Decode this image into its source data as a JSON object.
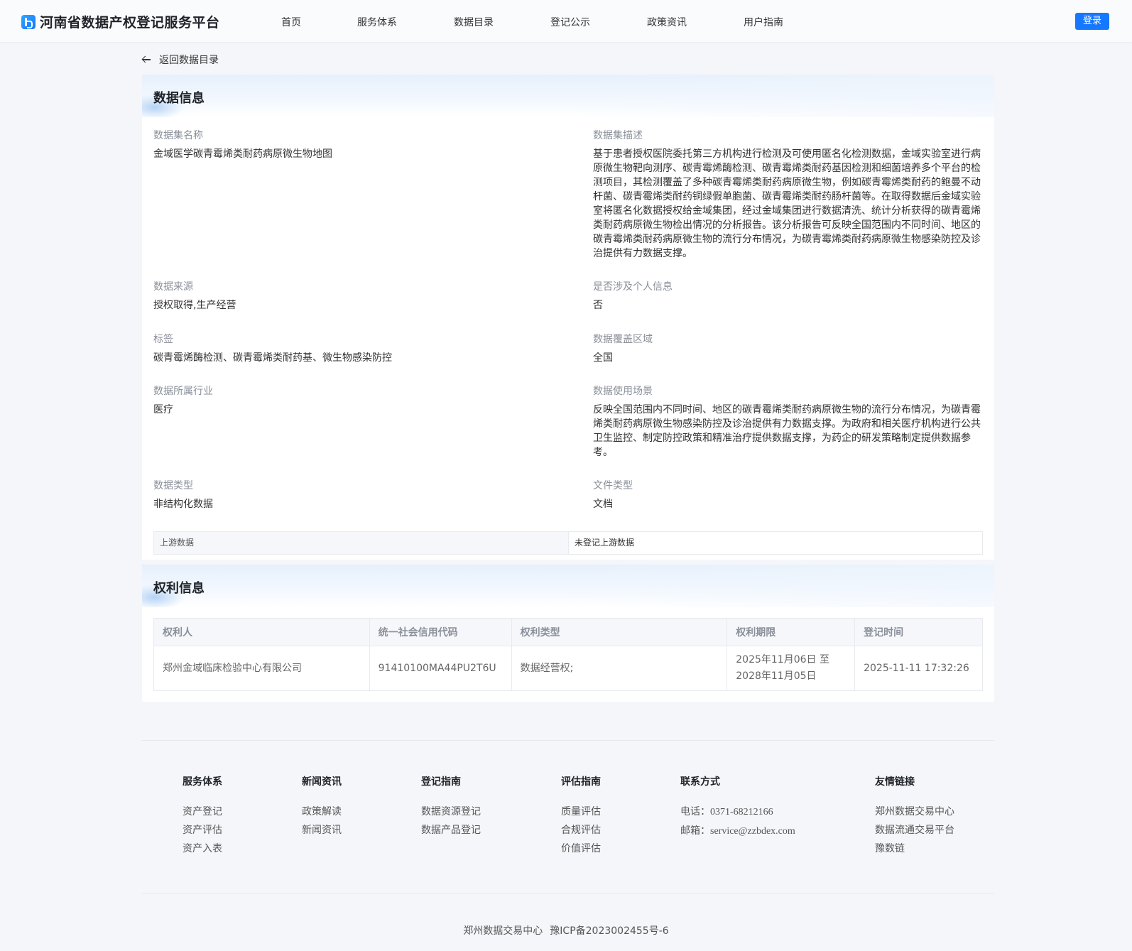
{
  "header": {
    "site_title": "河南省数据产权登记服务平台",
    "nav": [
      "首页",
      "服务体系",
      "数据目录",
      "登记公示",
      "政策资讯",
      "用户指南"
    ],
    "login_label": "登录",
    "brand_color": "#1677ff"
  },
  "back_link": "返回数据目录",
  "data_info": {
    "title": "数据信息",
    "fields": {
      "dataset_name": {
        "label": "数据集名称",
        "value": "金域医学碳青霉烯类耐药病原微生物地图"
      },
      "dataset_desc": {
        "label": "数据集描述",
        "value": "基于患者授权医院委托第三方机构进行检测及可使用匿名化检测数据，金域实验室进行病原微生物靶向测序、碳青霉烯酶检测、碳青霉烯类耐药基因检测和细菌培养多个平台的检测项目，其检测覆盖了多种碳青霉烯类耐药病原微生物，例如碳青霉烯类耐药的鲍曼不动杆菌、碳青霉烯类耐药铜绿假单胞菌、碳青霉烯类耐药肠杆菌等。在取得数据后金域实验室将匿名化数据授权给金域集团，经过金域集团进行数据清洗、统计分析获得的碳青霉烯类耐药病原微生物检出情况的分析报告。该分析报告可反映全国范围内不同时间、地区的碳青霉烯类耐药病原微生物的流行分布情况，为碳青霉烯类耐药病原微生物感染防控及诊治提供有力数据支撑。"
      },
      "data_source": {
        "label": "数据来源",
        "value": "授权取得,生产经营"
      },
      "personal_info": {
        "label": "是否涉及个人信息",
        "value": "否"
      },
      "tags": {
        "label": "标签",
        "value": "碳青霉烯酶检测、碳青霉烯类耐药基、微生物感染防控"
      },
      "coverage": {
        "label": "数据覆盖区域",
        "value": "全国"
      },
      "industry": {
        "label": "数据所属行业",
        "value": "医疗"
      },
      "scenario": {
        "label": "数据使用场景",
        "value": "反映全国范围内不同时间、地区的碳青霉烯类耐药病原微生物的流行分布情况，为碳青霉烯类耐药病原微生物感染防控及诊治提供有力数据支撑。为政府和相关医疗机构进行公共卫生监控、制定防控政策和精准治疗提供数据支撑，为药企的研发策略制定提供数据参考。"
      },
      "data_type": {
        "label": "数据类型",
        "value": "非结构化数据"
      },
      "file_type": {
        "label": "文件类型",
        "value": "文档"
      }
    },
    "upstream": {
      "label": "上游数据",
      "value": "未登记上游数据"
    }
  },
  "rights_info": {
    "title": "权利信息",
    "columns": [
      "权利人",
      "统一社会信用代码",
      "权利类型",
      "权利期限",
      "登记时间"
    ],
    "rows": [
      {
        "holder": "郑州金域临床检验中心有限公司",
        "credit_code": "91410100MA44PU2T6U",
        "right_type": "数据经营权;",
        "term_line1": "2025年11月06日 至",
        "term_line2": "2028年11月05日",
        "registered_at": "2025-11-11 17:32:26"
      }
    ]
  },
  "footer": {
    "columns": [
      {
        "title": "服务体系",
        "links": [
          "资产登记",
          "资产评估",
          "资产入表"
        ]
      },
      {
        "title": "新闻资讯",
        "links": [
          "政策解读",
          "新闻资讯"
        ]
      },
      {
        "title": "登记指南",
        "links": [
          "数据资源登记",
          "数据产品登记"
        ]
      },
      {
        "title": "评估指南",
        "links": [
          "质量评估",
          "合规评估",
          "价值评估"
        ]
      },
      {
        "title": "联系方式",
        "phone_label": "电话：",
        "phone": "0371-68212166",
        "email_label": "邮箱：",
        "email": "service@zzbdex.com"
      },
      {
        "title": "友情链接",
        "links": [
          "郑州数据交易中心",
          "数据流通交易平台",
          "豫数链"
        ]
      }
    ],
    "copyright_org": "郑州数据交易中心",
    "icp": "豫ICP备2023002455号-6"
  }
}
